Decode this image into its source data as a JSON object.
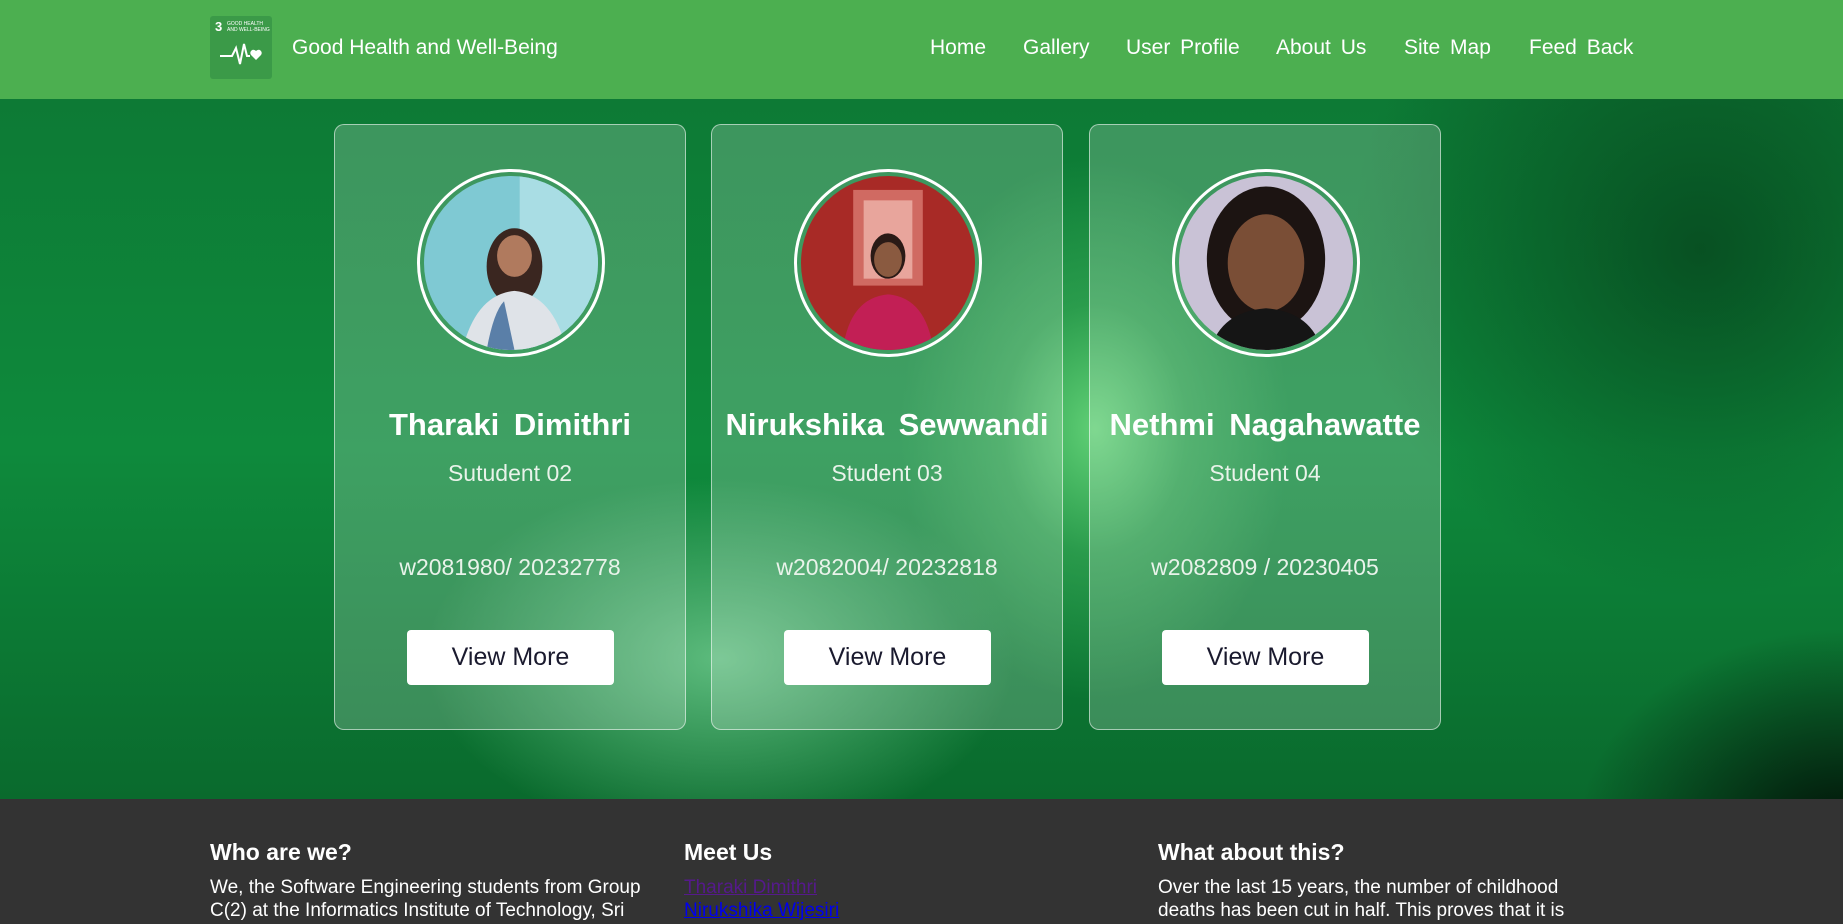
{
  "header": {
    "site_title": "Good Health and Well-Being",
    "logo": {
      "number": "3",
      "text_line1": "GOOD HEALTH",
      "text_line2": "AND WELL-BEING",
      "icon": "heartbeat-heart-icon"
    },
    "nav": [
      {
        "label": "Home"
      },
      {
        "label": "Gallery"
      },
      {
        "label": "User Profile"
      },
      {
        "label": "About Us"
      },
      {
        "label": "Site Map"
      },
      {
        "label": "Feed Back"
      }
    ]
  },
  "cards": [
    {
      "name": "Tharaki Dimithri",
      "role": "Sutudent 02",
      "id": "w2081980/ 20232778",
      "button": "View More"
    },
    {
      "name": "Nirukshika Sewwandi",
      "role": "Student 03",
      "id": "w2082004/ 20232818",
      "button": "View More"
    },
    {
      "name": "Nethmi Nagahawatte",
      "role": "Student 04",
      "id": "w2082809 / 20230405",
      "button": "View More"
    }
  ],
  "footer": {
    "who": {
      "heading": "Who are we?",
      "text": "We, the Software Engineering students from Group C(2) at the Informatics Institute of Technology, Sri"
    },
    "meet": {
      "heading": "Meet Us",
      "links": [
        {
          "label": "Tharaki Dimithri"
        },
        {
          "label": "Nirukshika Wijesiri"
        }
      ]
    },
    "what": {
      "heading": "What about this?",
      "text": "Over the last 15 years, the number of childhood deaths has been cut in half. This proves that it is"
    }
  },
  "colors": {
    "header_bg": "#4caf50",
    "footer_bg": "#333333",
    "accent_green": "#0e8a3c"
  }
}
